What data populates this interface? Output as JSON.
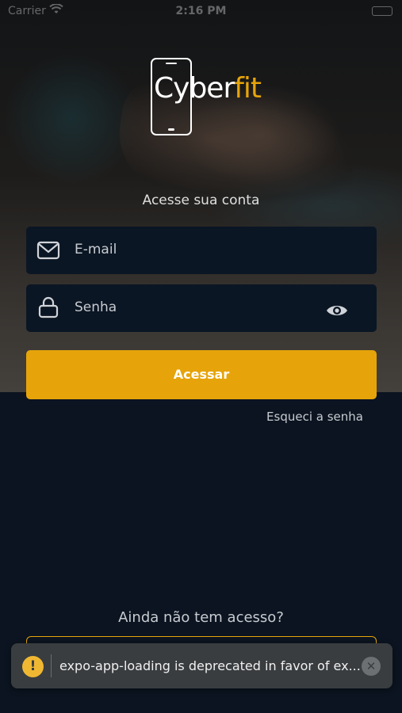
{
  "status_bar": {
    "carrier": "Carrier",
    "time": "2:16 PM"
  },
  "logo": {
    "brand_main": "Cyber",
    "brand_accent": "fit"
  },
  "login": {
    "title": "Acesse sua conta",
    "email_placeholder": "E-mail",
    "password_placeholder": "Senha",
    "submit_label": "Acessar",
    "forgot_label": "Esqueci a senha"
  },
  "signup": {
    "prompt": "Ainda não tem acesso?"
  },
  "toast": {
    "message": "expo-app-loading is deprecated in favor of ex..."
  },
  "colors": {
    "accent": "#e6a40a",
    "background": "#0b1420",
    "field": "#0b1624",
    "toast": "#3a3d40"
  },
  "icons": [
    "wifi-icon",
    "battery-icon",
    "mail-icon",
    "lock-icon",
    "eye-icon",
    "warning-icon",
    "close-icon"
  ]
}
